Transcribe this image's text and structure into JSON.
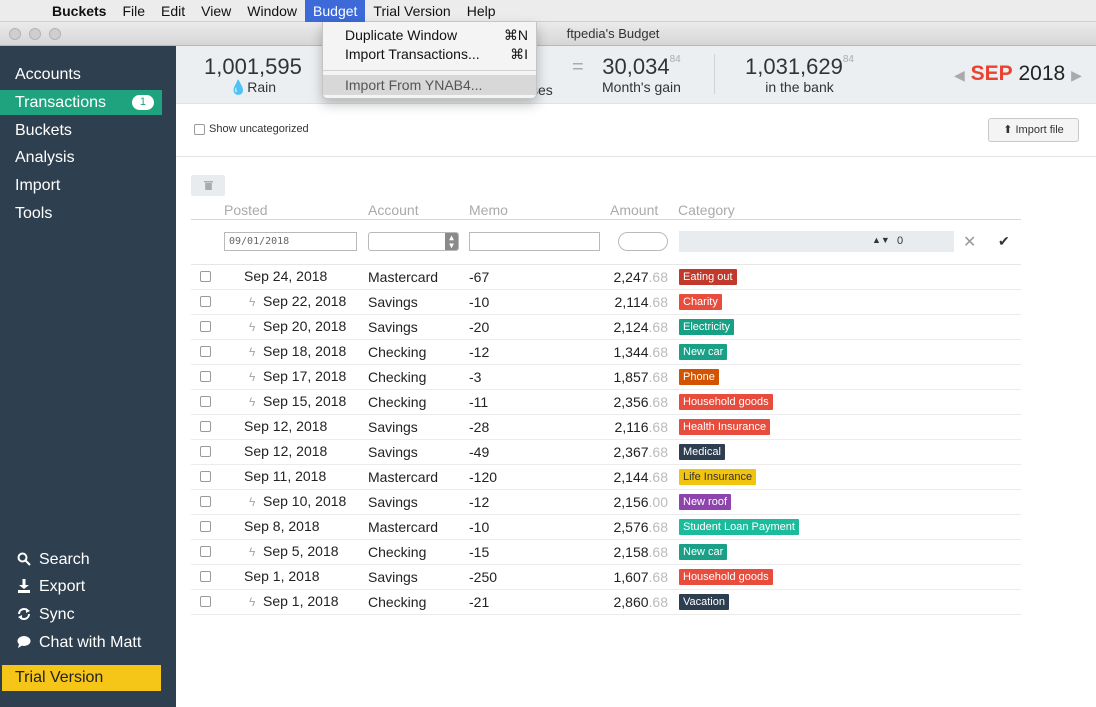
{
  "menubar": {
    "app": "Buckets",
    "items": [
      "File",
      "Edit",
      "View",
      "Window",
      "Budget",
      "Trial Version",
      "Help"
    ]
  },
  "window": {
    "title": "ftpedia's Budget"
  },
  "sidebar": {
    "nav": [
      {
        "label": "Accounts"
      },
      {
        "label": "Transactions",
        "badge": "1"
      },
      {
        "label": "Buckets"
      },
      {
        "label": "Analysis"
      },
      {
        "label": "Import"
      },
      {
        "label": "Tools"
      }
    ],
    "actions": [
      {
        "label": "Search",
        "icon": "search-icon"
      },
      {
        "label": "Export",
        "icon": "download-icon"
      },
      {
        "label": "Sync",
        "icon": "sync-icon"
      },
      {
        "label": "Chat with Matt",
        "icon": "chat-icon"
      }
    ],
    "trial_label": "Trial Version"
  },
  "summary": {
    "rain": {
      "value": "1,001,595",
      "label": "Rain"
    },
    "expenses": {
      "label": "ses"
    },
    "gain": {
      "value": "30,034",
      "cents": "84",
      "label": "Month's gain"
    },
    "bank": {
      "value": "1,031,629",
      "cents": "84",
      "label": "in the bank"
    },
    "month": "SEP",
    "year": "2018"
  },
  "budget_menu": {
    "items": [
      {
        "label": "Duplicate Window",
        "shortcut": "⌘N"
      },
      {
        "label": "Import Transactions...",
        "shortcut": "⌘I"
      },
      {
        "label": "Import From YNAB4..."
      }
    ]
  },
  "toolbar": {
    "show_uncategorized": "Show uncategorized",
    "import_file": "Import file"
  },
  "table": {
    "headers": [
      "Posted",
      "Account",
      "Memo",
      "Amount",
      "Category"
    ],
    "new_row": {
      "date": "09/01/2018",
      "category_amount": "0"
    },
    "rows": [
      {
        "date": "Sep 24, 2018",
        "bolt": false,
        "account": "Mastercard",
        "memo": "-67",
        "amount": "2,247",
        "cents": ".68",
        "category": "Eating out",
        "color": "#c0392b"
      },
      {
        "date": "Sep 22, 2018",
        "bolt": true,
        "account": "Savings",
        "memo": "-10",
        "amount": "2,114",
        "cents": ".68",
        "category": "Charity",
        "color": "#e74c3c"
      },
      {
        "date": "Sep 20, 2018",
        "bolt": true,
        "account": "Savings",
        "memo": "-20",
        "amount": "2,124",
        "cents": ".68",
        "category": "Electricity",
        "color": "#16a085"
      },
      {
        "date": "Sep 18, 2018",
        "bolt": true,
        "account": "Checking",
        "memo": "-12",
        "amount": "1,344",
        "cents": ".68",
        "category": "New car",
        "color": "#1aa086"
      },
      {
        "date": "Sep 17, 2018",
        "bolt": true,
        "account": "Checking",
        "memo": "-3",
        "amount": "1,857",
        "cents": ".68",
        "category": "Phone",
        "color": "#d35400"
      },
      {
        "date": "Sep 15, 2018",
        "bolt": true,
        "account": "Checking",
        "memo": "-11",
        "amount": "2,356",
        "cents": ".68",
        "category": "Household goods",
        "color": "#e74c3c"
      },
      {
        "date": "Sep 12, 2018",
        "bolt": false,
        "account": "Savings",
        "memo": "-28",
        "amount": "2,116",
        "cents": ".68",
        "category": "Health Insurance",
        "color": "#e74c3c"
      },
      {
        "date": "Sep 12, 2018",
        "bolt": false,
        "account": "Savings",
        "memo": "-49",
        "amount": "2,367",
        "cents": ".68",
        "category": "Medical",
        "color": "#2c3e50"
      },
      {
        "date": "Sep 11, 2018",
        "bolt": false,
        "account": "Mastercard",
        "memo": "-120",
        "amount": "2,144",
        "cents": ".68",
        "category": "Life Insurance",
        "color": "#f1c40f",
        "dark": true
      },
      {
        "date": "Sep 10, 2018",
        "bolt": true,
        "account": "Savings",
        "memo": "-12",
        "amount": "2,156",
        "cents": ".00",
        "category": "New roof",
        "color": "#8e44ad"
      },
      {
        "date": "Sep 8, 2018",
        "bolt": false,
        "account": "Mastercard",
        "memo": "-10",
        "amount": "2,576",
        "cents": ".68",
        "category": "Student Loan Payment",
        "color": "#1abc9c"
      },
      {
        "date": "Sep 5, 2018",
        "bolt": true,
        "account": "Checking",
        "memo": "-15",
        "amount": "2,158",
        "cents": ".68",
        "category": "New car",
        "color": "#1aa086"
      },
      {
        "date": "Sep 1, 2018",
        "bolt": false,
        "account": "Savings",
        "memo": "-250",
        "amount": "1,607",
        "cents": ".68",
        "category": "Household goods",
        "color": "#e74c3c"
      },
      {
        "date": "Sep 1, 2018",
        "bolt": true,
        "account": "Checking",
        "memo": "-21",
        "amount": "2,860",
        "cents": ".68",
        "category": "Vacation",
        "color": "#2c3e50"
      }
    ]
  }
}
